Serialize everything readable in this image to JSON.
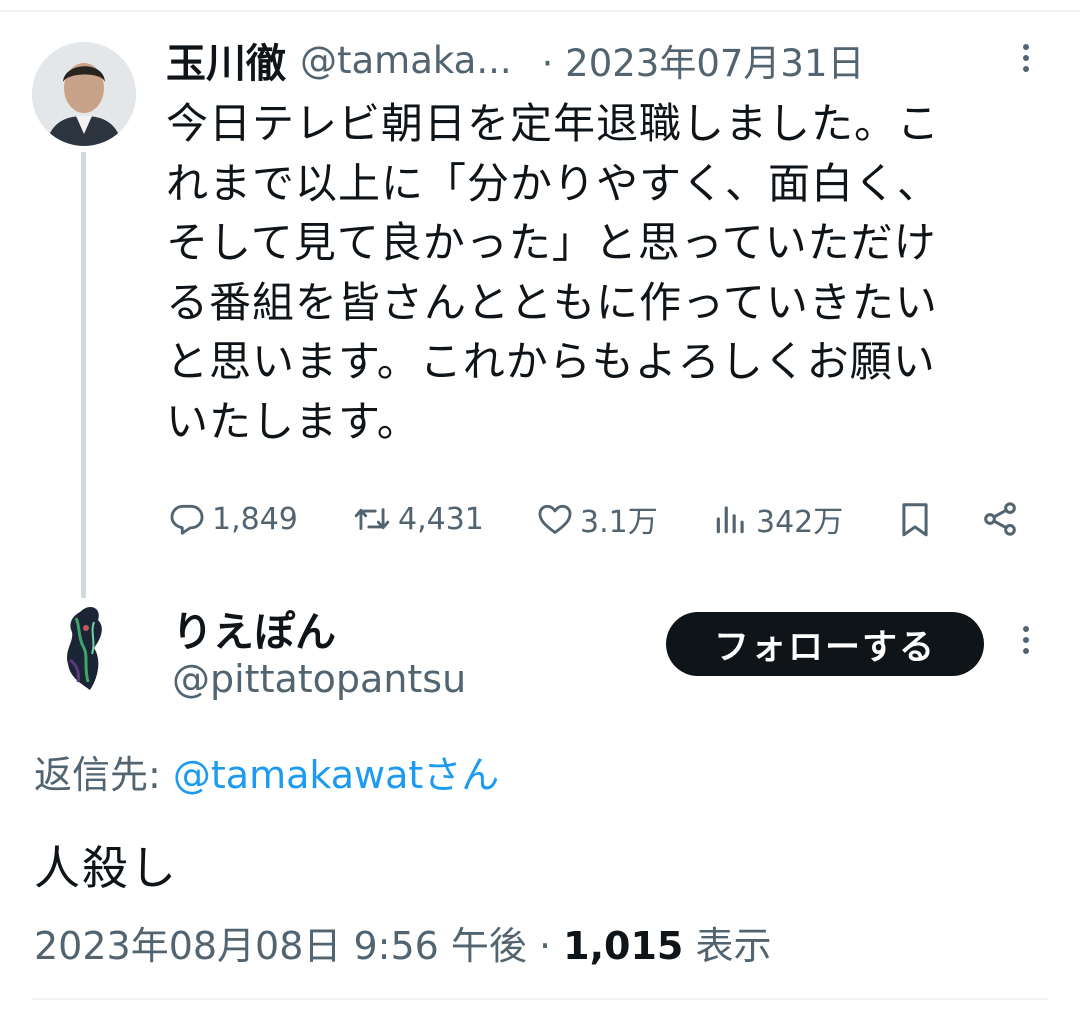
{
  "parent": {
    "name": "玉川徹",
    "handle": "@tamaka...",
    "separator": "·",
    "date": "2023年07月31日",
    "text": "今日テレビ朝日を定年退職しました。こ\nれまで以上に「分かりやすく、面白く、\nそして見て良かった」と思っていただけ\nる番組を皆さんとともに作っていきたい\nと思います。これからもよろしくお願い\nいたします。",
    "stats": {
      "replies": "1,849",
      "retweets": "4,431",
      "likes": "3.1万",
      "views": "342万"
    }
  },
  "reply": {
    "name": "りえぽん",
    "handle": "@pittatopantsu",
    "follow_label": "フォローする",
    "reply_to_prefix": "返信先: ",
    "reply_to_mention": "@tamakawat",
    "reply_to_suffix": "さん",
    "text": "人殺し",
    "timestamp": "2023年08月08日 9:56 午後",
    "meta_separator": " · ",
    "views_count": "1,015",
    "views_label": "表示"
  },
  "icons": [
    "reply-icon",
    "retweet-icon",
    "like-icon",
    "views-icon",
    "bookmark-icon",
    "share-icon",
    "more-icon"
  ],
  "colors": {
    "text": "#0f1419",
    "secondary": "#536471",
    "link": "#1d9bf0",
    "thread_line": "#cfd9de",
    "follow_button": "#0f1419"
  }
}
